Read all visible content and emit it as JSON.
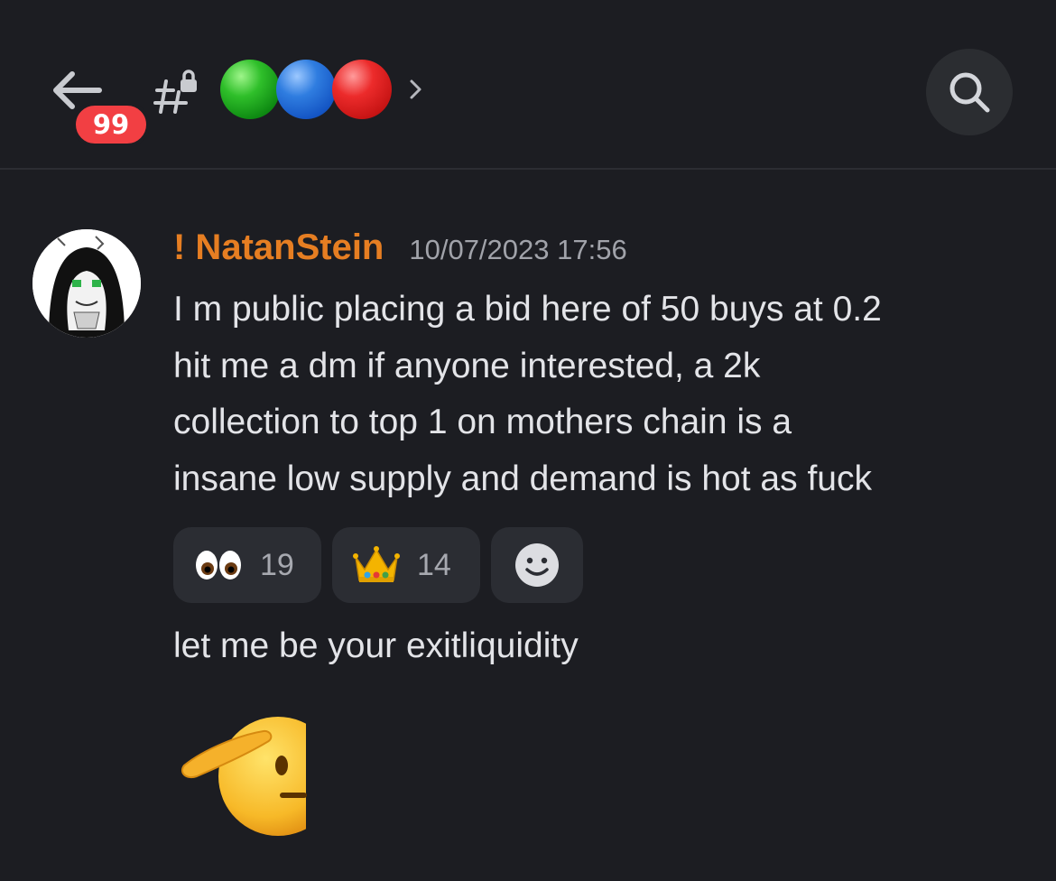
{
  "header": {
    "badge_count": "99",
    "channel_icon": "hashtag-lock-icon",
    "channel_name_icons": [
      "green-circle-emoji",
      "blue-circle-emoji",
      "red-circle-emoji"
    ],
    "chevron_icon": "chevron-right-icon",
    "search_icon": "search-icon"
  },
  "message": {
    "username": "! NatanStein",
    "username_color": "#e67e22",
    "timestamp": "10/07/2023 17:56",
    "lines": [
      "I m public placing a bid here of 50 buys at 0.2",
      "hit me a dm if anyone interested, a 2k",
      "collection to top 1 on mothers chain is a",
      "insane low supply and demand is hot as fuck"
    ],
    "reactions": [
      {
        "emoji": "eyes-emoji",
        "count": "19"
      },
      {
        "emoji": "crown-emoji",
        "count": "14"
      }
    ],
    "add_reaction_icon": "add-reaction-smiley-icon",
    "followup_text": "let me be your exitliquidity",
    "followup_emoji": "saluting-face-emoji"
  },
  "colors": {
    "background": "#1c1d22",
    "badge": "#f23f43",
    "reaction_bg": "#2b2d33"
  }
}
